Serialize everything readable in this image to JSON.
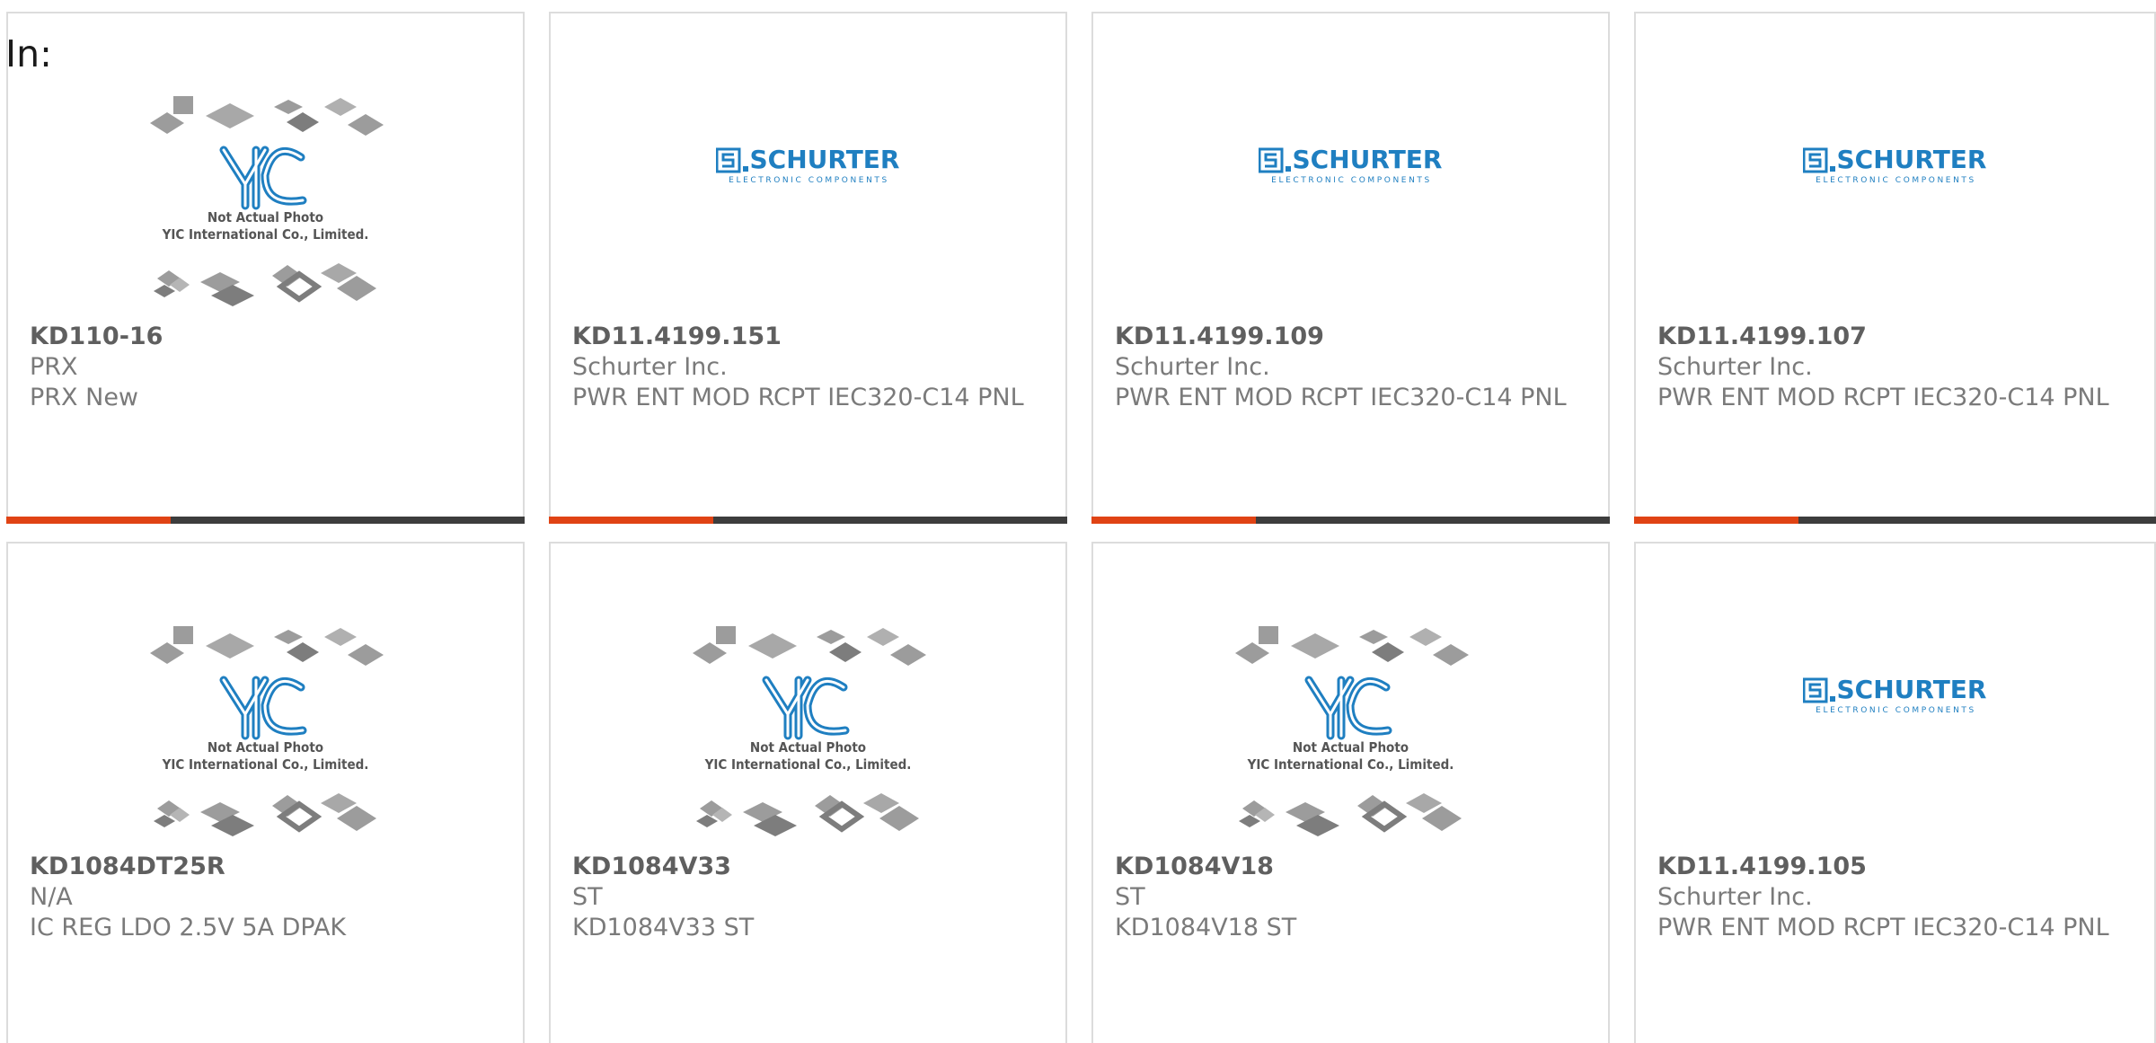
{
  "header": {
    "in_label": "In:"
  },
  "images": {
    "yic": {
      "line1": "Not Actual Photo",
      "line2": "YIC International Co., Limited.",
      "logo": "YIC"
    },
    "schurter": {
      "brand": "SCHURTER",
      "tagline": "ELECTRONIC COMPONENTS",
      "color": "#1f7fc1"
    }
  },
  "products": [
    {
      "image": "yic",
      "part": "KD110-16",
      "manufacturer": "PRX",
      "description": "PRX New"
    },
    {
      "image": "schurter",
      "part": "KD11.4199.151",
      "manufacturer": "Schurter Inc.",
      "description": "PWR ENT MOD RCPT IEC320-C14 PNL"
    },
    {
      "image": "schurter",
      "part": "KD11.4199.109",
      "manufacturer": "Schurter Inc.",
      "description": "PWR ENT MOD RCPT IEC320-C14 PNL"
    },
    {
      "image": "schurter",
      "part": "KD11.4199.107",
      "manufacturer": "Schurter Inc.",
      "description": "PWR ENT MOD RCPT IEC320-C14 PNL"
    },
    {
      "image": "yic",
      "part": "KD1084DT25R",
      "manufacturer": "N/A",
      "description": "IC REG LDO 2.5V 5A DPAK"
    },
    {
      "image": "yic",
      "part": "KD1084V33",
      "manufacturer": "ST",
      "description": "KD1084V33 ST"
    },
    {
      "image": "yic",
      "part": "KD1084V18",
      "manufacturer": "ST",
      "description": "KD1084V18 ST"
    },
    {
      "image": "schurter",
      "part": "KD11.4199.105",
      "manufacturer": "Schurter Inc.",
      "description": "PWR ENT MOD RCPT IEC320-C14 PNL"
    }
  ],
  "colors": {
    "accent": "#e04314",
    "bar": "#3d3d3d",
    "text": "#7a7a7a",
    "part": "#5f5f5f"
  }
}
